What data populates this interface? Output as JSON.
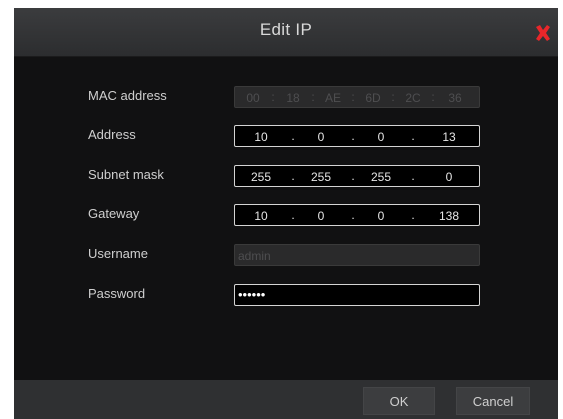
{
  "dialog": {
    "title": "Edit IP",
    "close_icon": "close-icon",
    "accent_color": "#e8262a"
  },
  "fields": {
    "mac": {
      "label": "MAC address",
      "segments": [
        "00",
        "18",
        "AE",
        "6D",
        "2C",
        "36"
      ],
      "separator": ":",
      "enabled": false
    },
    "address": {
      "label": "Address",
      "segments": [
        "10",
        "0",
        "0",
        "13"
      ],
      "separator": "."
    },
    "subnet": {
      "label": "Subnet mask",
      "segments": [
        "255",
        "255",
        "255",
        "0"
      ],
      "separator": "."
    },
    "gateway": {
      "label": "Gateway",
      "segments": [
        "10",
        "0",
        "0",
        "138"
      ],
      "separator": "."
    },
    "username": {
      "label": "Username",
      "value": "admin",
      "enabled": false
    },
    "password": {
      "label": "Password",
      "value": "••••••"
    }
  },
  "buttons": {
    "ok": "OK",
    "cancel": "Cancel"
  }
}
